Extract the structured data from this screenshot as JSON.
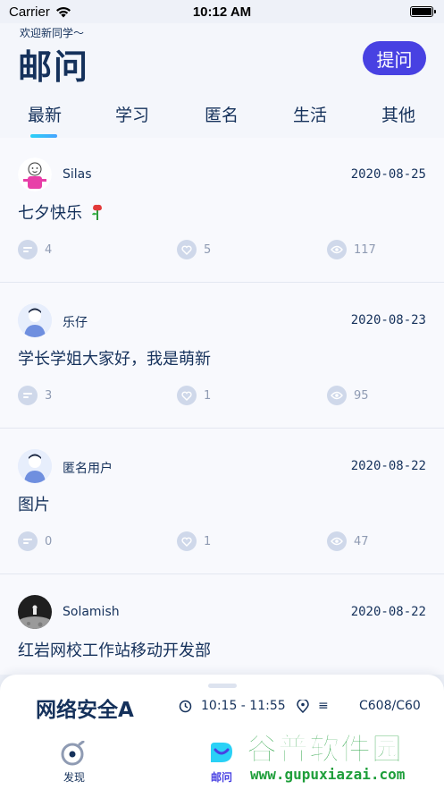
{
  "status_bar": {
    "carrier": "Carrier",
    "time": "10:12 AM",
    "battery": 1.0
  },
  "header": {
    "welcome": "欢迎新同学～",
    "title": "邮问",
    "ask_button": "提问"
  },
  "tabs": [
    {
      "label": "最新",
      "active": true
    },
    {
      "label": "学习",
      "active": false
    },
    {
      "label": "匿名",
      "active": false
    },
    {
      "label": "生活",
      "active": false
    },
    {
      "label": "其他",
      "active": false
    }
  ],
  "posts": [
    {
      "username": "Silas",
      "date": "2020-08-25",
      "content": "七夕快乐",
      "comments": "4",
      "likes": "5",
      "views": "117",
      "avatar": "cartoon-avatar"
    },
    {
      "username": "乐仔",
      "date": "2020-08-23",
      "content": "学长学姐大家好，我是萌新",
      "comments": "3",
      "likes": "1",
      "views": "95",
      "avatar": "default-avatar"
    },
    {
      "username": "匿名用户",
      "date": "2020-08-22",
      "content": "图片",
      "comments": "0",
      "likes": "1",
      "views": "47",
      "avatar": "default-avatar"
    },
    {
      "username": "Solamish",
      "date": "2020-08-22",
      "content": "红岩网校工作站移动开发部",
      "avatar": "moon-avatar"
    }
  ],
  "course_sheet": {
    "name": "网络安全A",
    "time": "10:15 - 11:55",
    "place": "≡",
    "room": "C608/C60"
  },
  "bottom_nav": [
    {
      "label": "发现",
      "icon": "compass-icon",
      "active": false
    },
    {
      "label": "邮问",
      "icon": "chat-icon",
      "active": true
    }
  ],
  "watermark": {
    "title": "谷普软件园",
    "url": "www.gupuxiazai.com"
  },
  "colors": {
    "primary": "#4841e2",
    "text": "#15315b",
    "accent": "#2ad1f6",
    "muted": "#8f9bb3"
  }
}
